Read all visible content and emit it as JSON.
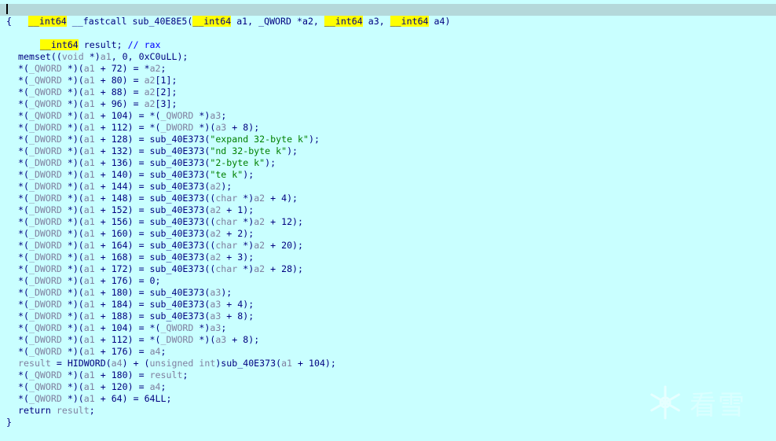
{
  "signature": {
    "ret_type": "__int64",
    "callconv": " __fastcall sub_40E8E5(",
    "p1_type": "__int64",
    "p1_name": " a1, _QWORD *a2, ",
    "p3_type": "__int64",
    "p3_name": " a3, ",
    "p4_type": "__int64",
    "p4_name": " a4)"
  },
  "open_brace": "{",
  "close_brace": "}",
  "decl": {
    "type": "__int64",
    "rest": " result; ",
    "comment": "// rax"
  },
  "lines": [
    "memset((void *)a1, 0, 0xC0uLL);",
    "*(_QWORD *)(a1 + 72) = *a2;",
    "*(_QWORD *)(a1 + 80) = a2[1];",
    "*(_QWORD *)(a1 + 88) = a2[2];",
    "*(_QWORD *)(a1 + 96) = a2[3];",
    "*(_QWORD *)(a1 + 104) = *(_QWORD *)a3;",
    "*(_DWORD *)(a1 + 112) = *(_DWORD *)(a3 + 8);",
    "*(_DWORD *)(a1 + 128) = sub_40E373(\"expand 32-byte k\");",
    "*(_DWORD *)(a1 + 132) = sub_40E373(\"nd 32-byte k\");",
    "*(_DWORD *)(a1 + 136) = sub_40E373(\"2-byte k\");",
    "*(_DWORD *)(a1 + 140) = sub_40E373(\"te k\");",
    "*(_DWORD *)(a1 + 144) = sub_40E373(a2);",
    "*(_DWORD *)(a1 + 148) = sub_40E373((char *)a2 + 4);",
    "*(_DWORD *)(a1 + 152) = sub_40E373(a2 + 1);",
    "*(_DWORD *)(a1 + 156) = sub_40E373((char *)a2 + 12);",
    "*(_DWORD *)(a1 + 160) = sub_40E373(a2 + 2);",
    "*(_DWORD *)(a1 + 164) = sub_40E373((char *)a2 + 20);",
    "*(_DWORD *)(a1 + 168) = sub_40E373(a2 + 3);",
    "*(_DWORD *)(a1 + 172) = sub_40E373((char *)a2 + 28);",
    "*(_DWORD *)(a1 + 176) = 0;",
    "*(_DWORD *)(a1 + 180) = sub_40E373(a3);",
    "*(_DWORD *)(a1 + 184) = sub_40E373(a3 + 4);",
    "*(_DWORD *)(a1 + 188) = sub_40E373(a3 + 8);",
    "*(_QWORD *)(a1 + 104) = *(_QWORD *)a3;",
    "*(_DWORD *)(a1 + 112) = *(_DWORD *)(a3 + 8);",
    "*(_QWORD *)(a1 + 176) = a4;",
    "result = HIDWORD(a4) + (unsigned int)sub_40E373(a1 + 104);",
    "*(_QWORD *)(a1 + 180) = result;",
    "*(_QWORD *)(a1 + 120) = a4;",
    "*(_QWORD *)(a1 + 64) = 64LL;",
    "return result;"
  ],
  "watermark": {
    "text": "看雪",
    "icon": "snowflake-icon"
  },
  "colors": {
    "background": "#c9ffff",
    "highlight_line": "#b4d8da",
    "keyword_highlight": "#ffff00",
    "code": "#000080",
    "string": "#008000",
    "comment": "#0000ff",
    "type": "#8080a0"
  }
}
